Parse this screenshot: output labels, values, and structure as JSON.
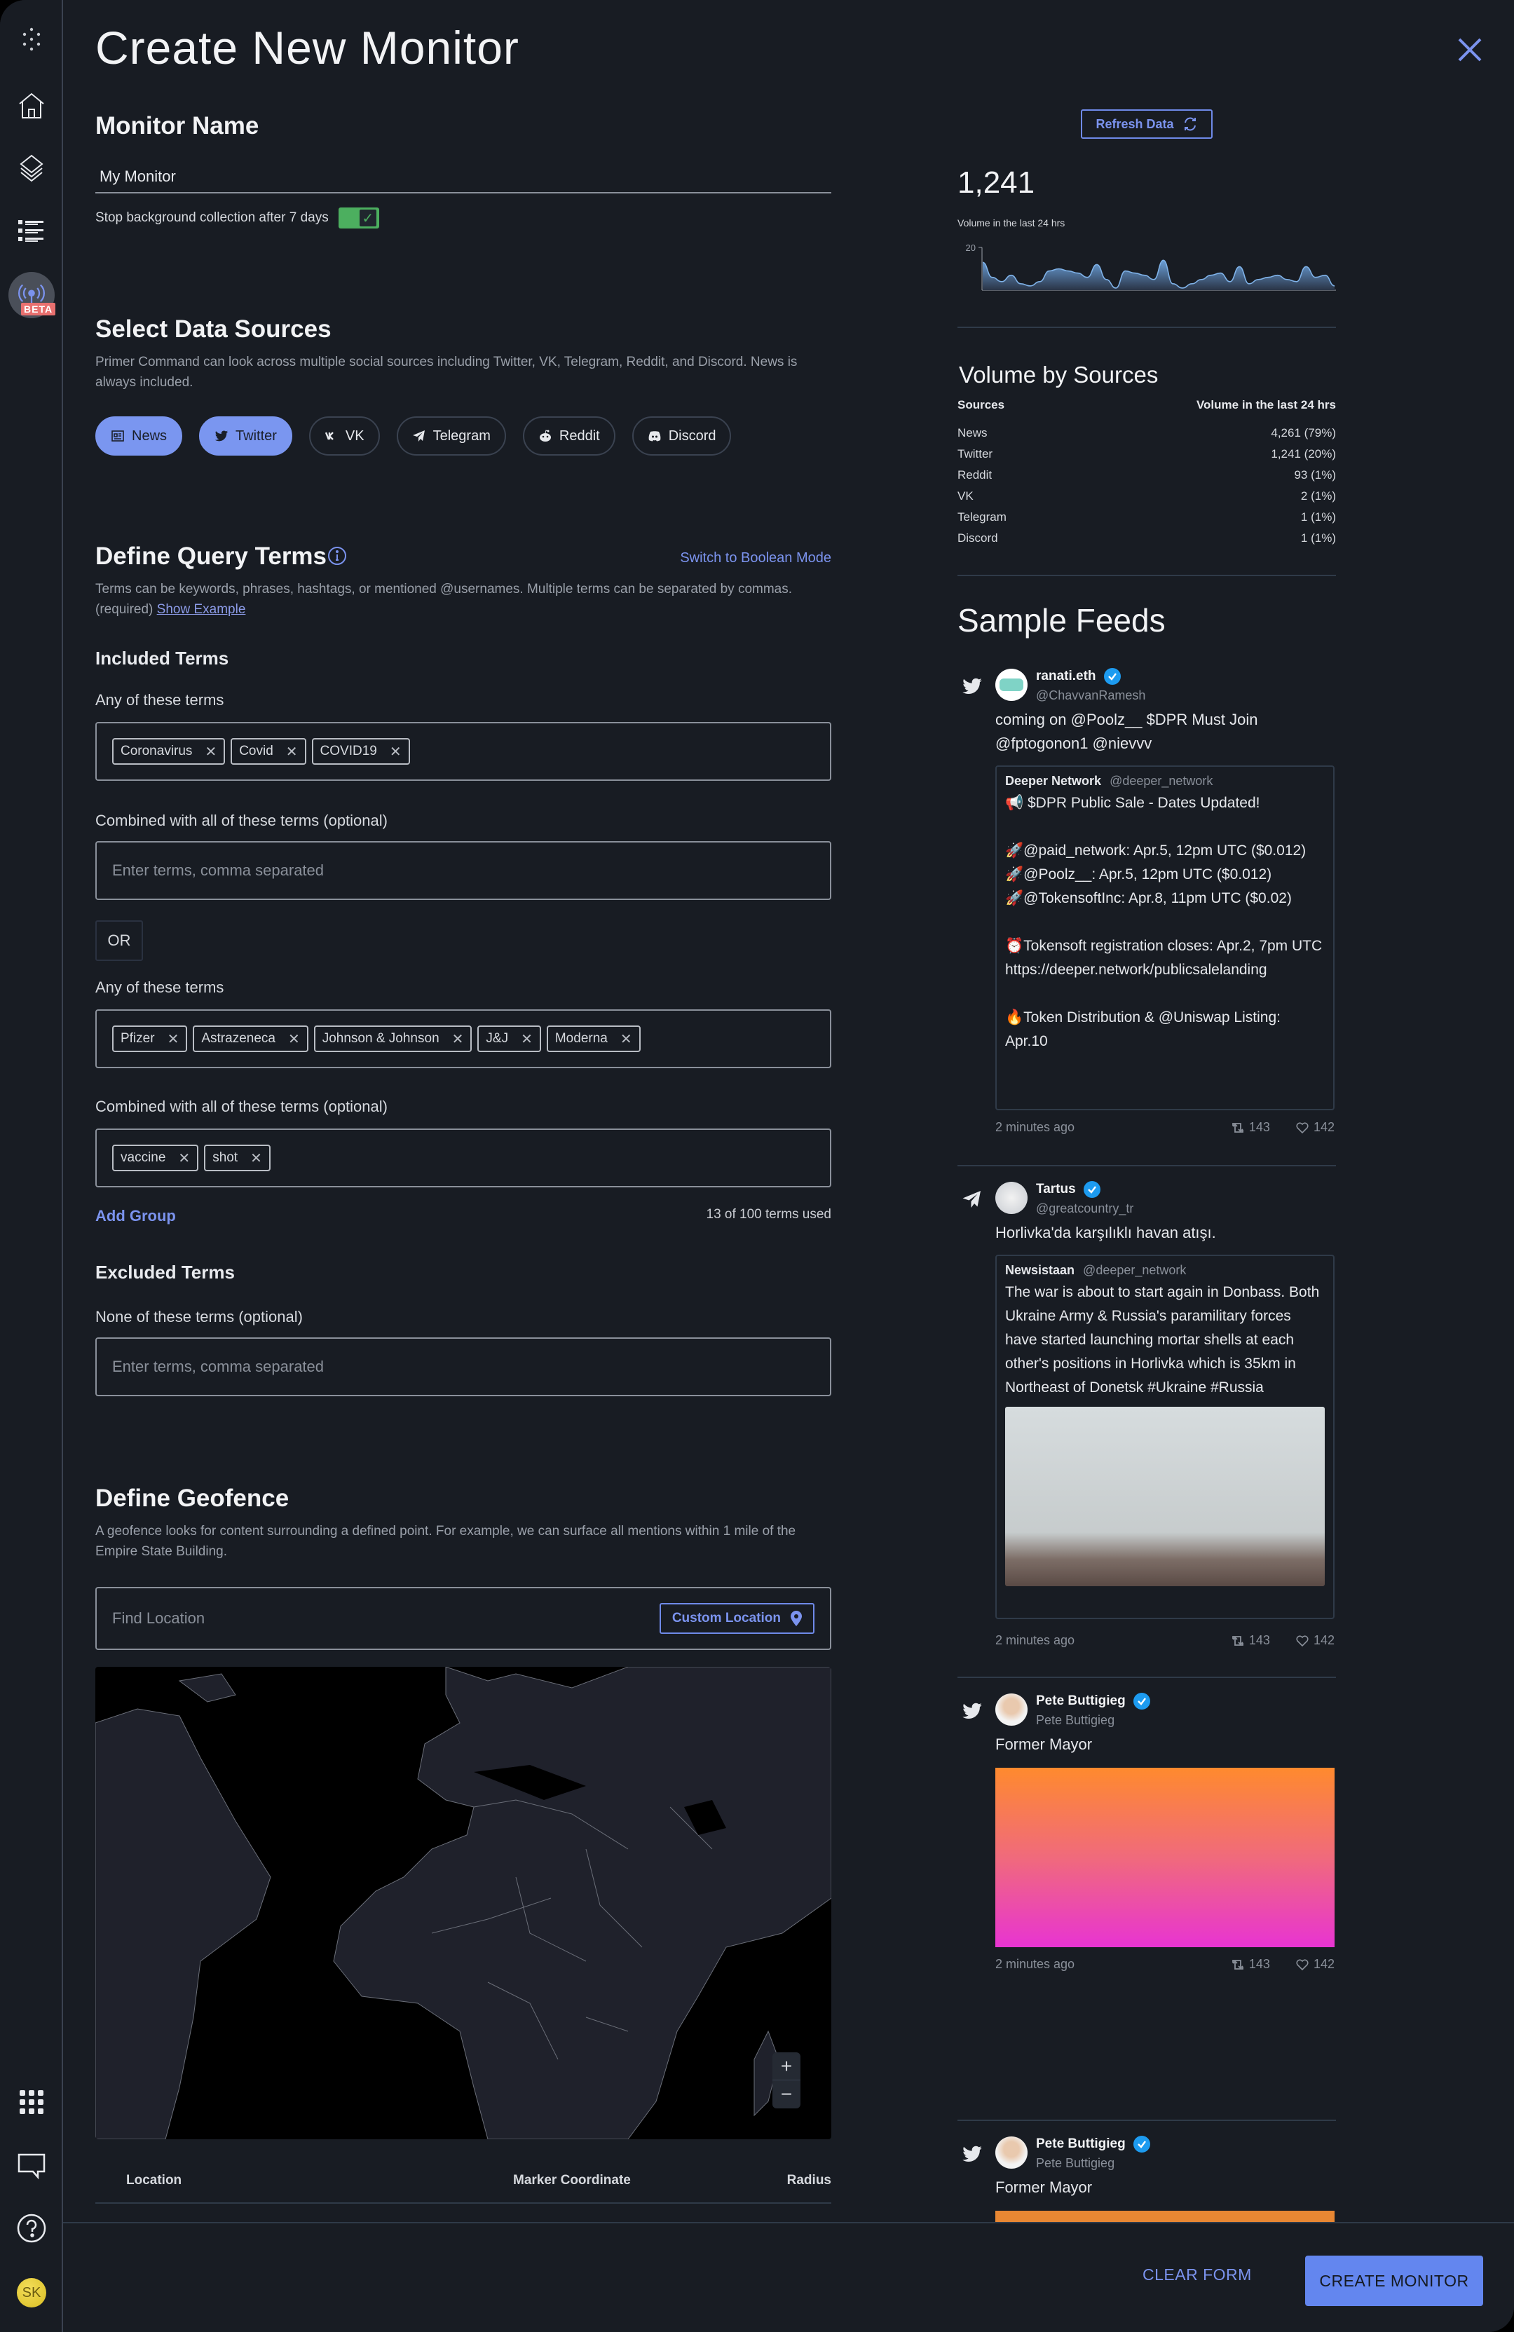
{
  "page": {
    "title": "Create New Monitor",
    "close_label": "close"
  },
  "sidebar": {
    "items": [
      {
        "name": "logo",
        "icon": "dots-logo-icon"
      },
      {
        "name": "home",
        "icon": "home-icon"
      },
      {
        "name": "layers",
        "icon": "layers-icon"
      },
      {
        "name": "list",
        "icon": "list-icon"
      },
      {
        "name": "monitors-beta",
        "icon": "broadcast-icon",
        "badge": "BETA"
      }
    ],
    "bottom": [
      {
        "name": "apps",
        "icon": "grid-icon"
      },
      {
        "name": "feedback",
        "icon": "chat-icon"
      },
      {
        "name": "help",
        "icon": "help-icon"
      }
    ],
    "user_initials": "SK"
  },
  "monitor_name": {
    "heading": "Monitor Name",
    "value": "My Monitor",
    "toggle_label": "Stop background collection after 7 days",
    "toggle_on": true
  },
  "data_sources": {
    "heading": "Select Data Sources",
    "description": "Primer Command can look across multiple social sources including Twitter, VK, Telegram, Reddit, and Discord. News is always included.",
    "sources": [
      {
        "label": "News",
        "icon": "news-icon",
        "selected": true
      },
      {
        "label": "Twitter",
        "icon": "twitter-icon",
        "selected": true
      },
      {
        "label": "VK",
        "icon": "vk-icon",
        "selected": false
      },
      {
        "label": "Telegram",
        "icon": "telegram-icon",
        "selected": false
      },
      {
        "label": "Reddit",
        "icon": "reddit-icon",
        "selected": false
      },
      {
        "label": "Discord",
        "icon": "discord-icon",
        "selected": false
      }
    ]
  },
  "query_terms": {
    "heading": "Define Query Terms",
    "boolean_link": "Switch to Boolean Mode",
    "description": "Terms can be keywords, phrases, hashtags, or mentioned @usernames. Multiple terms can be separated by commas. (required)",
    "show_example": "Show Example",
    "included_heading": "Included Terms",
    "any_label": "Any of these terms",
    "combined_label": "Combined with all of these terms (optional)",
    "placeholder": "Enter terms, comma separated",
    "or_label": "OR",
    "group1_any": [
      "Coronavirus",
      "Covid",
      "COVID19"
    ],
    "group1_all": [],
    "group2_any": [
      "Pfizer",
      "Astrazeneca",
      "Johnson & Johnson",
      "J&J",
      "Moderna"
    ],
    "group2_all": [
      "vaccine",
      "shot"
    ],
    "add_group": "Add Group",
    "terms_used": "13 of 100 terms used",
    "excluded_heading": "Excluded Terms",
    "none_label": "None of these terms (optional)"
  },
  "geofence": {
    "heading": "Define Geofence",
    "description": "A geofence looks for content surrounding a defined point. For example, we can surface all mentions within 1 mile of the Empire State Building.",
    "find_placeholder": "Find Location",
    "custom_location": "Custom Location",
    "zoom_in": "+",
    "zoom_out": "−",
    "table_headers": [
      "Location",
      "Marker Coordinate",
      "Radius"
    ]
  },
  "stats": {
    "refresh_label": "Refresh Data",
    "count": "1,241",
    "count_caption": "Volume in the last 24 hrs",
    "sources_title": "Volume by Sources",
    "sources_col": "Sources",
    "volume_col": "Volume in the last 24 hrs",
    "rows": [
      {
        "source": "News",
        "volume": "4,261 (79%)"
      },
      {
        "source": "Twitter",
        "volume": "1,241 (20%)"
      },
      {
        "source": "Reddit",
        "volume": "93 (1%)"
      },
      {
        "source": "VK",
        "volume": "2 (1%)"
      },
      {
        "source": "Telegram",
        "volume": "1 (1%)"
      },
      {
        "source": "Discord",
        "volume": "1 (1%)"
      }
    ]
  },
  "chart_data": {
    "type": "area",
    "title": "Volume in the last 24 hrs",
    "ylabel": "",
    "xlabel": "",
    "ylim": [
      0,
      20
    ],
    "yticks": [
      "20"
    ],
    "values": [
      13,
      6,
      4,
      7,
      3,
      2,
      4,
      9,
      10,
      9,
      8,
      6,
      12,
      5,
      1,
      9,
      8,
      7,
      5,
      14,
      3,
      1,
      3,
      5,
      7,
      8,
      4,
      11,
      3,
      5,
      6,
      7,
      5,
      4,
      11,
      6,
      7,
      2
    ]
  },
  "feeds": {
    "title": "Sample Feeds",
    "items": [
      {
        "source": "twitter-icon",
        "name": "ranati.eth",
        "handle": "@ChavvanRamesh",
        "verified": true,
        "text": "coming on @Poolz__  $DPR Must Join @fptogonon1 @nievvv",
        "quote_name": "Deeper Network",
        "quote_handle": "@deeper_network",
        "quote_text": "📢 $DPR Public Sale - Dates Updated!\n\n🚀@paid_network: Apr.5, 12pm UTC ($0.012)\n🚀@Poolz__: Apr.5, 12pm UTC ($0.012)\n🚀@TokensoftInc: Apr.8, 11pm UTC ($0.02)\n\n⏰Tokensoft registration closes: Apr.2, 7pm UTC\nhttps://deeper.network/publicsalelanding\n\n🔥Token Distribution & @Uniswap Listing: Apr.10",
        "time": "2 minutes ago",
        "retweets": "143",
        "likes": "142"
      },
      {
        "source": "telegram-icon",
        "name": "Tartus",
        "handle": "@greatcountry_tr",
        "verified": true,
        "text": "Horlivka'da karşılıklı havan atışı.",
        "quote_name": "Newsistaan",
        "quote_handle": "@deeper_network",
        "quote_text": "The war is about to start again in Donbass. Both Ukraine Army & Russia's paramilitary forces have started launching mortar shells at each other's positions in Horlivka which is 35km in Northeast of Donetsk #Ukraine #Russia",
        "time": "2 minutes ago",
        "retweets": "143",
        "likes": "142"
      },
      {
        "source": "twitter-icon",
        "name": "Pete Buttigieg",
        "handle": "Pete Buttigieg",
        "verified": true,
        "text": "Former Mayor",
        "time": "2 minutes ago",
        "retweets": "143",
        "likes": "142"
      },
      {
        "source": "twitter-icon",
        "name": "Pete Buttigieg",
        "handle": "Pete Buttigieg",
        "verified": true,
        "text": "Former Mayor"
      }
    ]
  },
  "footer": {
    "clear_label": "CLEAR FORM",
    "create_label": "CREATE MONITOR"
  },
  "colors": {
    "accent": "#6386ef",
    "link": "#7b93ee",
    "toggle_on": "#4caf5f",
    "verified": "#1d9bf0",
    "beta": "#e8706f"
  }
}
